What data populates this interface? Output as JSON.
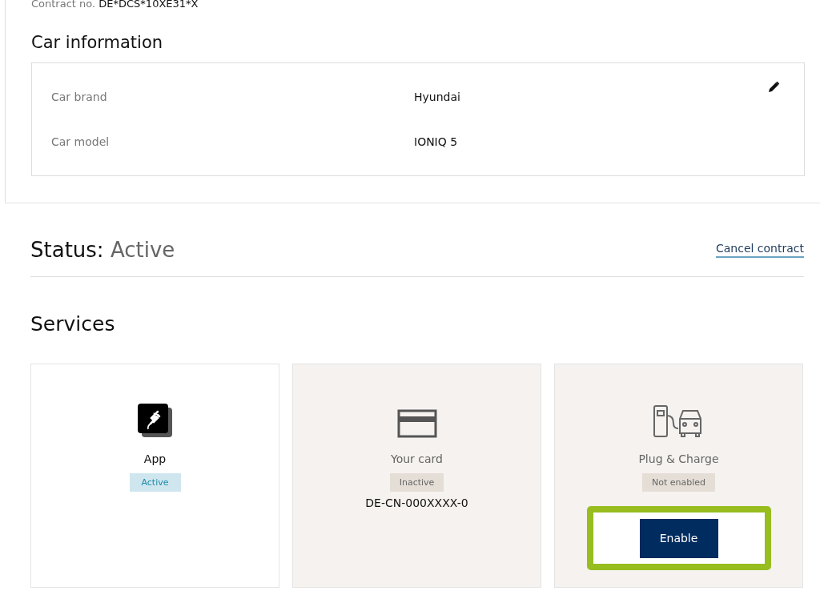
{
  "contract": {
    "label": "Contract no.",
    "value": "DE*DCS*10XE31*X"
  },
  "car_information": {
    "title": "Car information",
    "rows": [
      {
        "label": "Car brand",
        "value": "Hyundai"
      },
      {
        "label": "Car model",
        "value": "IONIQ 5"
      }
    ]
  },
  "status": {
    "label": "Status:",
    "value": "Active",
    "action": "Cancel contract"
  },
  "services": {
    "title": "Services",
    "items": [
      {
        "kind": "app",
        "name": "App",
        "active": true,
        "badge": "Active"
      },
      {
        "kind": "card",
        "name": "Your card",
        "active": false,
        "badge": "Inactive",
        "number": "DE-CN-000XXXX-0"
      },
      {
        "kind": "charge",
        "name": "Plug & Charge",
        "active": false,
        "badge": "Not enabled",
        "button": {
          "label": "Enable",
          "highlighted": true
        }
      }
    ]
  }
}
